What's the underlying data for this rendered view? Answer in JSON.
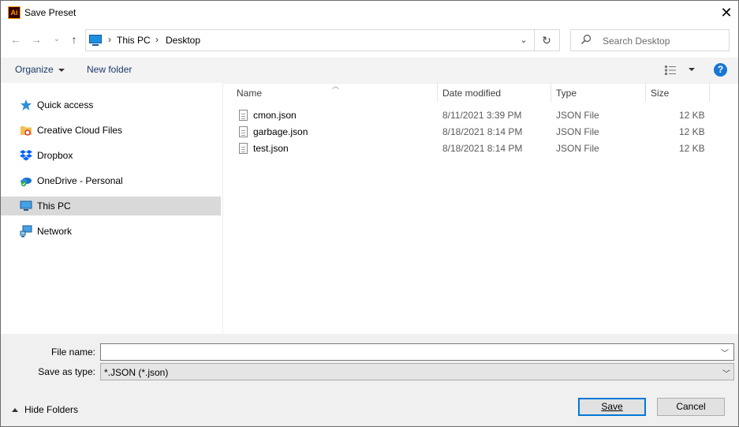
{
  "window": {
    "title": "Save Preset",
    "app_icon_text": "Ai",
    "close_glyph": "✕"
  },
  "nav": {
    "back": "←",
    "forward": "→",
    "recent": "⌄",
    "up": "↑"
  },
  "address": {
    "crumbs": [
      "This PC",
      "Desktop"
    ],
    "separator": "›",
    "dropdown": "⌄",
    "refresh": "↻"
  },
  "search": {
    "placeholder": "Search Desktop"
  },
  "toolbar": {
    "organize": "Organize",
    "new_folder": "New folder",
    "help": "?"
  },
  "sidebar": {
    "items": [
      {
        "label": "Quick access",
        "icon": "star-icon"
      },
      {
        "label": "Creative Cloud Files",
        "icon": "creative-cloud-folder-icon"
      },
      {
        "label": "Dropbox",
        "icon": "dropbox-icon"
      },
      {
        "label": "OneDrive - Personal",
        "icon": "onedrive-icon"
      },
      {
        "label": "This PC",
        "icon": "computer-icon",
        "selected": true
      },
      {
        "label": "Network",
        "icon": "network-icon"
      }
    ]
  },
  "columns": {
    "name": "Name",
    "date": "Date modified",
    "type": "Type",
    "size": "Size"
  },
  "files": [
    {
      "name": "cmon.json",
      "date": "8/11/2021 3:39 PM",
      "type": "JSON File",
      "size": "12 KB"
    },
    {
      "name": "garbage.json",
      "date": "8/18/2021 8:14 PM",
      "type": "JSON File",
      "size": "12 KB"
    },
    {
      "name": "test.json",
      "date": "8/18/2021 8:14 PM",
      "type": "JSON File",
      "size": "12 KB"
    }
  ],
  "form": {
    "file_name_label": "File name:",
    "file_name_value": "",
    "save_type_label": "Save as type:",
    "save_type_value": "*.JSON (*.json)"
  },
  "footer": {
    "hide_folders": "Hide Folders",
    "save": "Save",
    "cancel": "Cancel"
  },
  "colors": {
    "accent": "#0078d7",
    "selection": "#d9d9d9",
    "help": "#1976d2"
  }
}
